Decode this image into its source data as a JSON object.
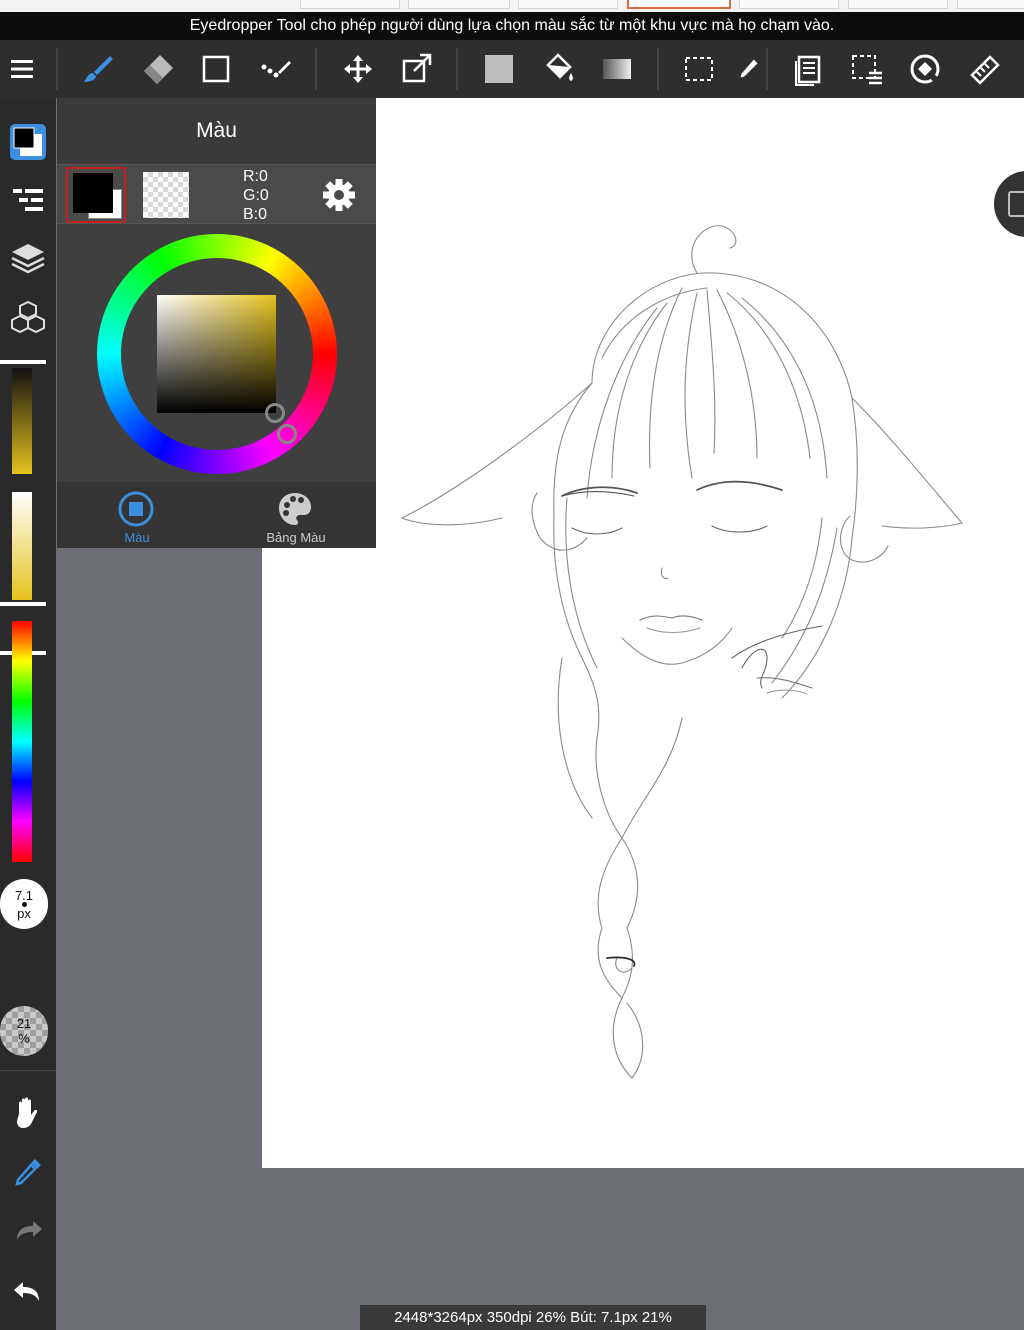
{
  "hint": {
    "text": "Eyedropper Tool cho phép người dùng lựa chọn màu sắc từ một khu vực mà họ chạm vào."
  },
  "toolbar": {
    "items": [
      {
        "icon": "menu-icon"
      },
      {
        "icon": "brush-icon",
        "active": true
      },
      {
        "icon": "eraser-icon"
      },
      {
        "icon": "rectangle-icon"
      },
      {
        "icon": "dot-pen-icon"
      },
      {
        "icon": "move-icon"
      },
      {
        "icon": "transform-icon"
      },
      {
        "icon": "fill-color-icon"
      },
      {
        "icon": "bucket-icon"
      },
      {
        "icon": "gradient-icon"
      },
      {
        "icon": "select-rect-icon"
      },
      {
        "icon": "select-pen-icon"
      },
      {
        "icon": "pages-icon"
      },
      {
        "icon": "selection-menu-icon"
      },
      {
        "icon": "rotate-snap-icon"
      },
      {
        "icon": "ruler-icon"
      }
    ]
  },
  "color_panel": {
    "title": "Màu",
    "foreground_color": "#000000",
    "rgb": {
      "r": "R:0",
      "g": "G:0",
      "b": "B:0"
    },
    "hue_color": "#e6c21c",
    "tabs": [
      {
        "label": "Màu",
        "icon": "color-icon",
        "active": true
      },
      {
        "label": "Bảng Màu",
        "icon": "palette-icon",
        "active": false
      }
    ]
  },
  "sidebar": {
    "brush_size": {
      "value": "7.1",
      "unit": "px"
    },
    "opacity": {
      "value": "21",
      "unit": "%"
    },
    "accent_color": "#3c8ede"
  },
  "status": {
    "text": "2448*3264px 350dpi 26% Bút: 7.1px 21%"
  },
  "colors": {
    "toolbar_bg": "#2e2e2e",
    "panel_bg": "#3f3f3f",
    "workspace_bg": "#6b6e72",
    "accent_blue": "#3c8ede",
    "selection_red": "#c51e1e"
  }
}
